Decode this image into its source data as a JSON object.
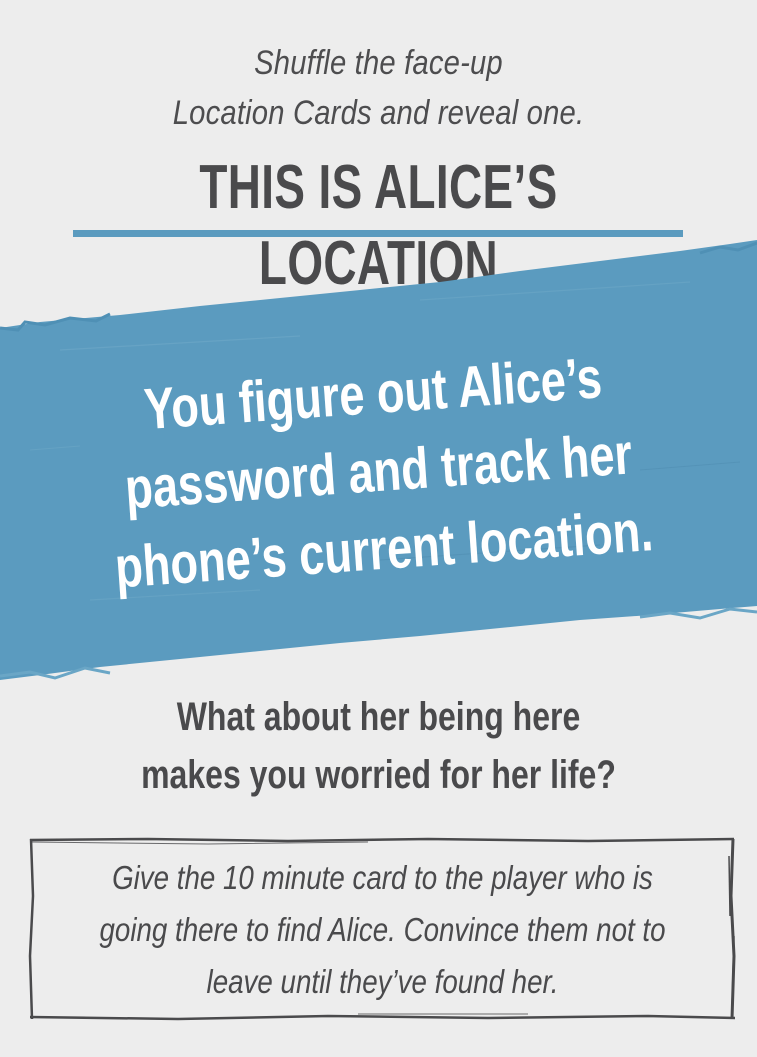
{
  "card": {
    "instruction_lines": [
      "Shuffle the face-up",
      "Location Cards and reveal one."
    ],
    "title": "THIS IS ALICE’S LOCATION",
    "banner_lines": [
      "You figure out Alice’s",
      "password and track her",
      "phone’s current location."
    ],
    "question_lines": [
      "What about her being here",
      "makes you worried for her life?"
    ],
    "note_lines": [
      "Give the 10 minute card to the player who is",
      "going there to find Alice. Convince them not to",
      "leave until they’ve found her."
    ]
  },
  "colors": {
    "background": "#ededed",
    "text": "#4a4a4c",
    "accent_blue": "#5b9bbf",
    "banner_text": "#ffffff"
  }
}
